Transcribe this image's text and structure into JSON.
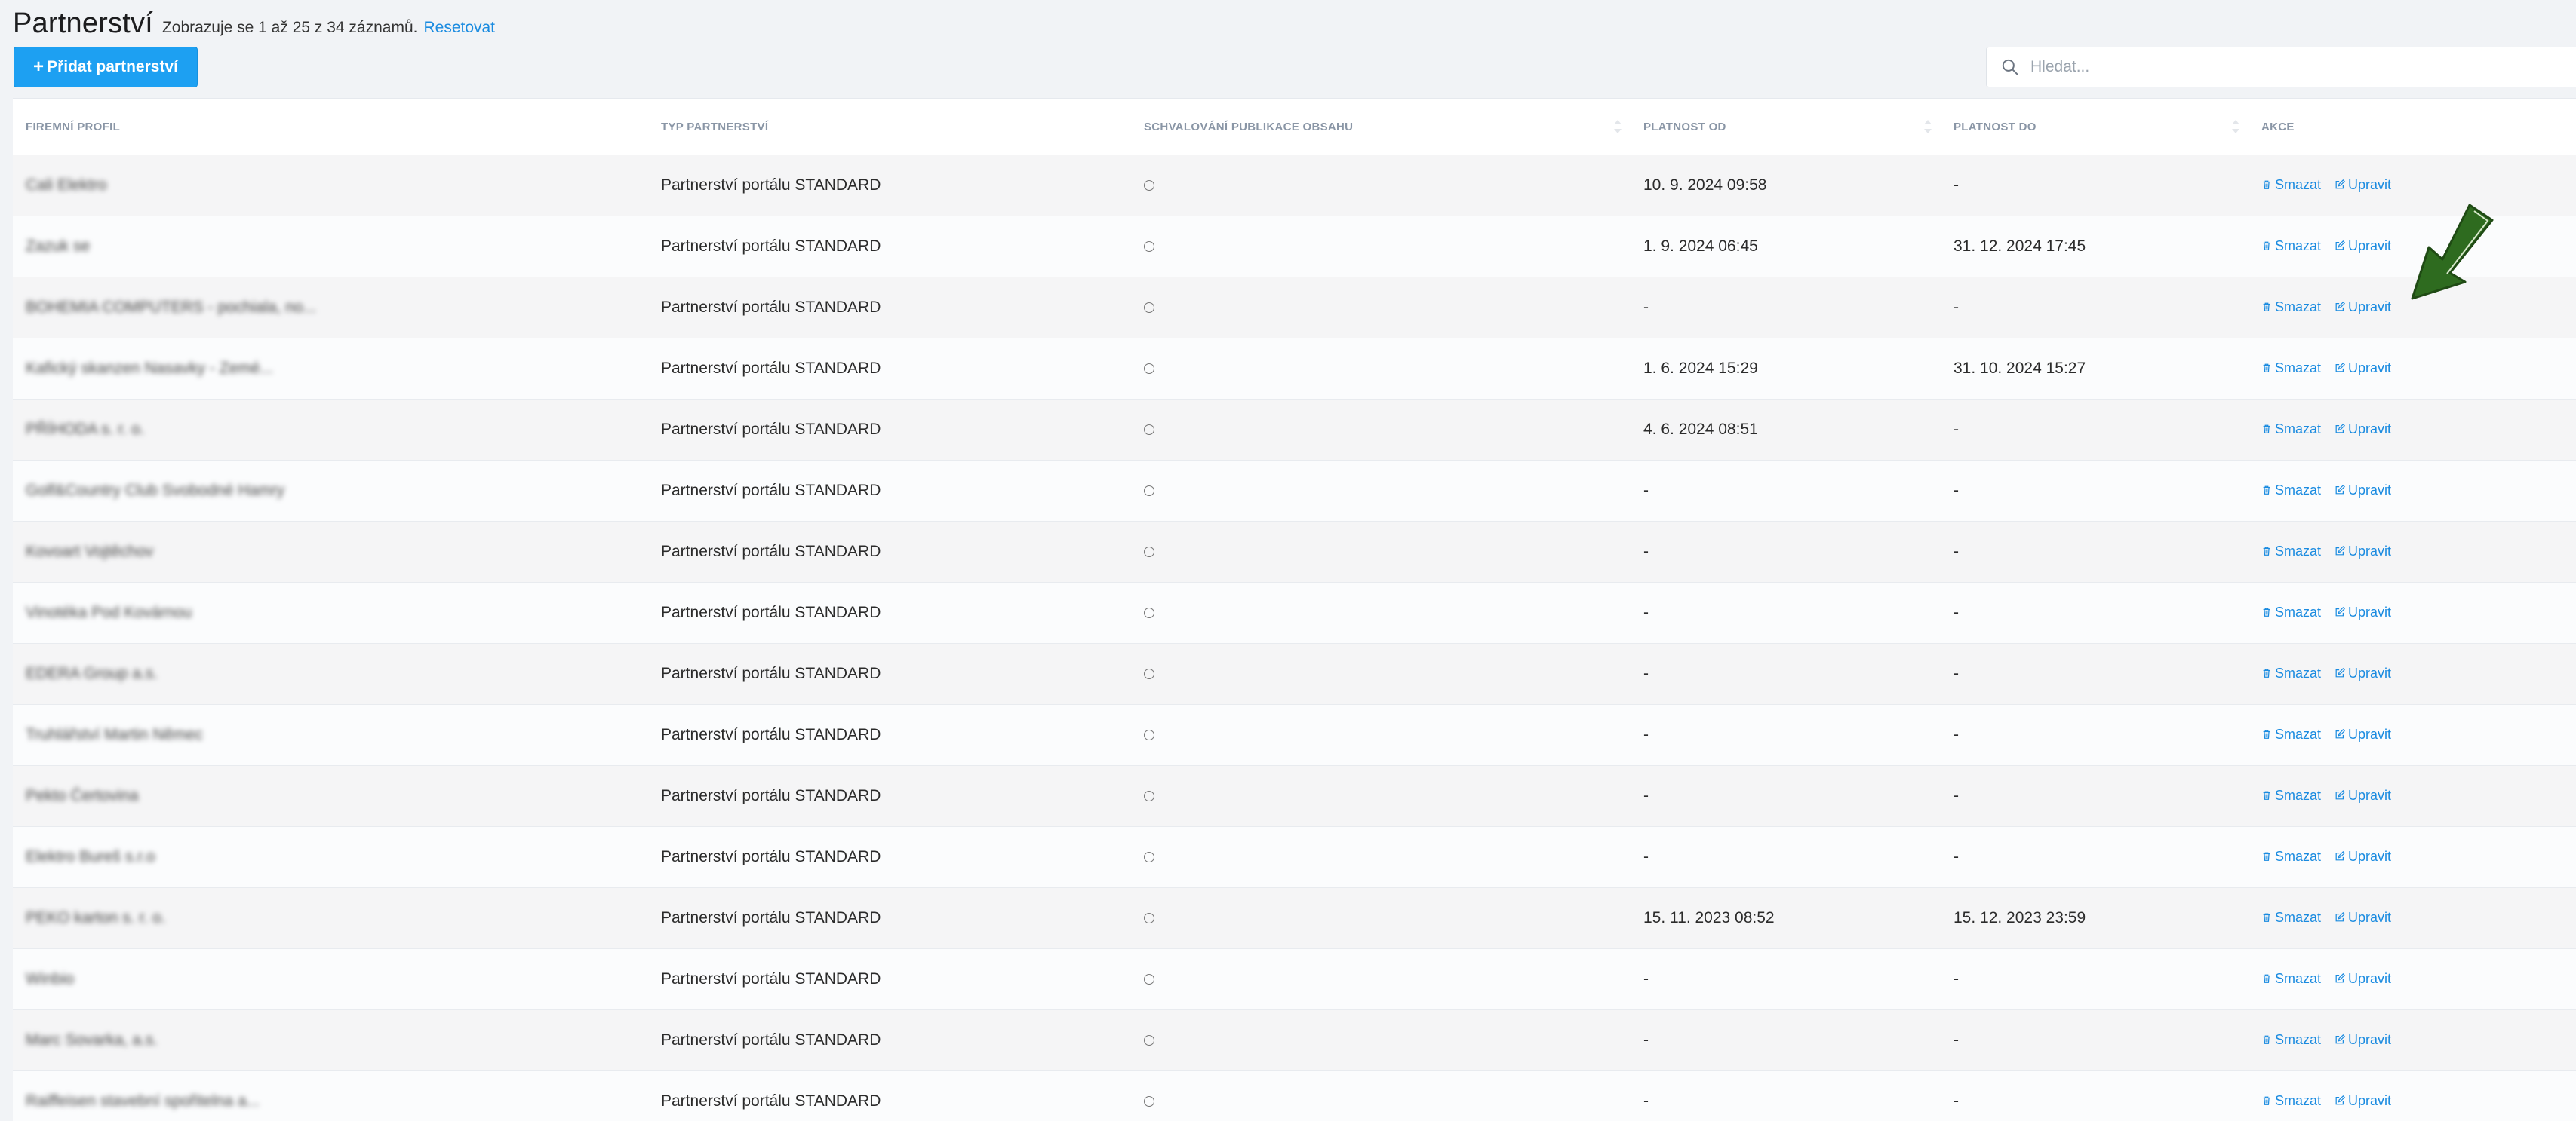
{
  "header": {
    "title": "Partnerství",
    "subtitle": "Zobrazuje se 1 až 25 z 34 záznamů.",
    "reset_label": "Resetovat"
  },
  "toolbar": {
    "add_label": "Přidat partnerství",
    "search_placeholder": "Hledat..."
  },
  "table": {
    "columns": [
      "FIREMNÍ PROFIL",
      "TYP PARTNERSTVÍ",
      "SCHVALOVÁNÍ PUBLIKACE OBSAHU",
      "PLATNOST OD",
      "PLATNOST DO",
      "AKCE"
    ],
    "delete_label": "Smazat",
    "edit_label": "Upravit",
    "rows": [
      {
        "profile": "Cali Elektro",
        "type": "Partnerství portálu STANDARD",
        "from": "10. 9. 2024 09:58",
        "to": "-"
      },
      {
        "profile": "Zazuk se",
        "type": "Partnerství portálu STANDARD",
        "from": "1. 9. 2024 06:45",
        "to": "31. 12. 2024 17:45"
      },
      {
        "profile": "BOHEMIA COMPUTERS - pochiala, no...",
        "type": "Partnerství portálu STANDARD",
        "from": "-",
        "to": "-"
      },
      {
        "profile": "Kafický skanzen Nasavky - Zemé...",
        "type": "Partnerství portálu STANDARD",
        "from": "1. 6. 2024 15:29",
        "to": "31. 10. 2024 15:27"
      },
      {
        "profile": "PŘÍHODA s. r. o.",
        "type": "Partnerství portálu STANDARD",
        "from": "4. 6. 2024 08:51",
        "to": "-"
      },
      {
        "profile": "Golf&Country Club Svobodné Hamry",
        "type": "Partnerství portálu STANDARD",
        "from": "-",
        "to": "-"
      },
      {
        "profile": "Kovoart Vojtěchov",
        "type": "Partnerství portálu STANDARD",
        "from": "-",
        "to": "-"
      },
      {
        "profile": "Vinotéka Pod Kovárnou",
        "type": "Partnerství portálu STANDARD",
        "from": "-",
        "to": "-"
      },
      {
        "profile": "EDERA Group a.s.",
        "type": "Partnerství portálu STANDARD",
        "from": "-",
        "to": "-"
      },
      {
        "profile": "Truhlářství Martin Němec",
        "type": "Partnerství portálu STANDARD",
        "from": "-",
        "to": "-"
      },
      {
        "profile": "Pekto Čertovina",
        "type": "Partnerství portálu STANDARD",
        "from": "-",
        "to": "-"
      },
      {
        "profile": "Elektro Bureš s.r.o",
        "type": "Partnerství portálu STANDARD",
        "from": "-",
        "to": "-"
      },
      {
        "profile": "PEKO karton s. r. o.",
        "type": "Partnerství portálu STANDARD",
        "from": "15. 11. 2023 08:52",
        "to": "15. 12. 2023 23:59"
      },
      {
        "profile": "Winbio",
        "type": "Partnerství portálu STANDARD",
        "from": "-",
        "to": "-"
      },
      {
        "profile": "Marc Sovarka, a.s.",
        "type": "Partnerství portálu STANDARD",
        "from": "-",
        "to": "-"
      },
      {
        "profile": "Raiffeisen stavební spořitelna a...",
        "type": "Partnerství portálu STANDARD",
        "from": "-",
        "to": "-"
      }
    ]
  },
  "colors": {
    "accent": "#1da0f2",
    "link": "#1a8be0",
    "annotation_arrow": "#2e6b1f"
  },
  "icons": {
    "search": "search-icon",
    "delete": "trash-icon",
    "edit": "edit-icon",
    "annotation": "arrow-down-left-icon"
  }
}
